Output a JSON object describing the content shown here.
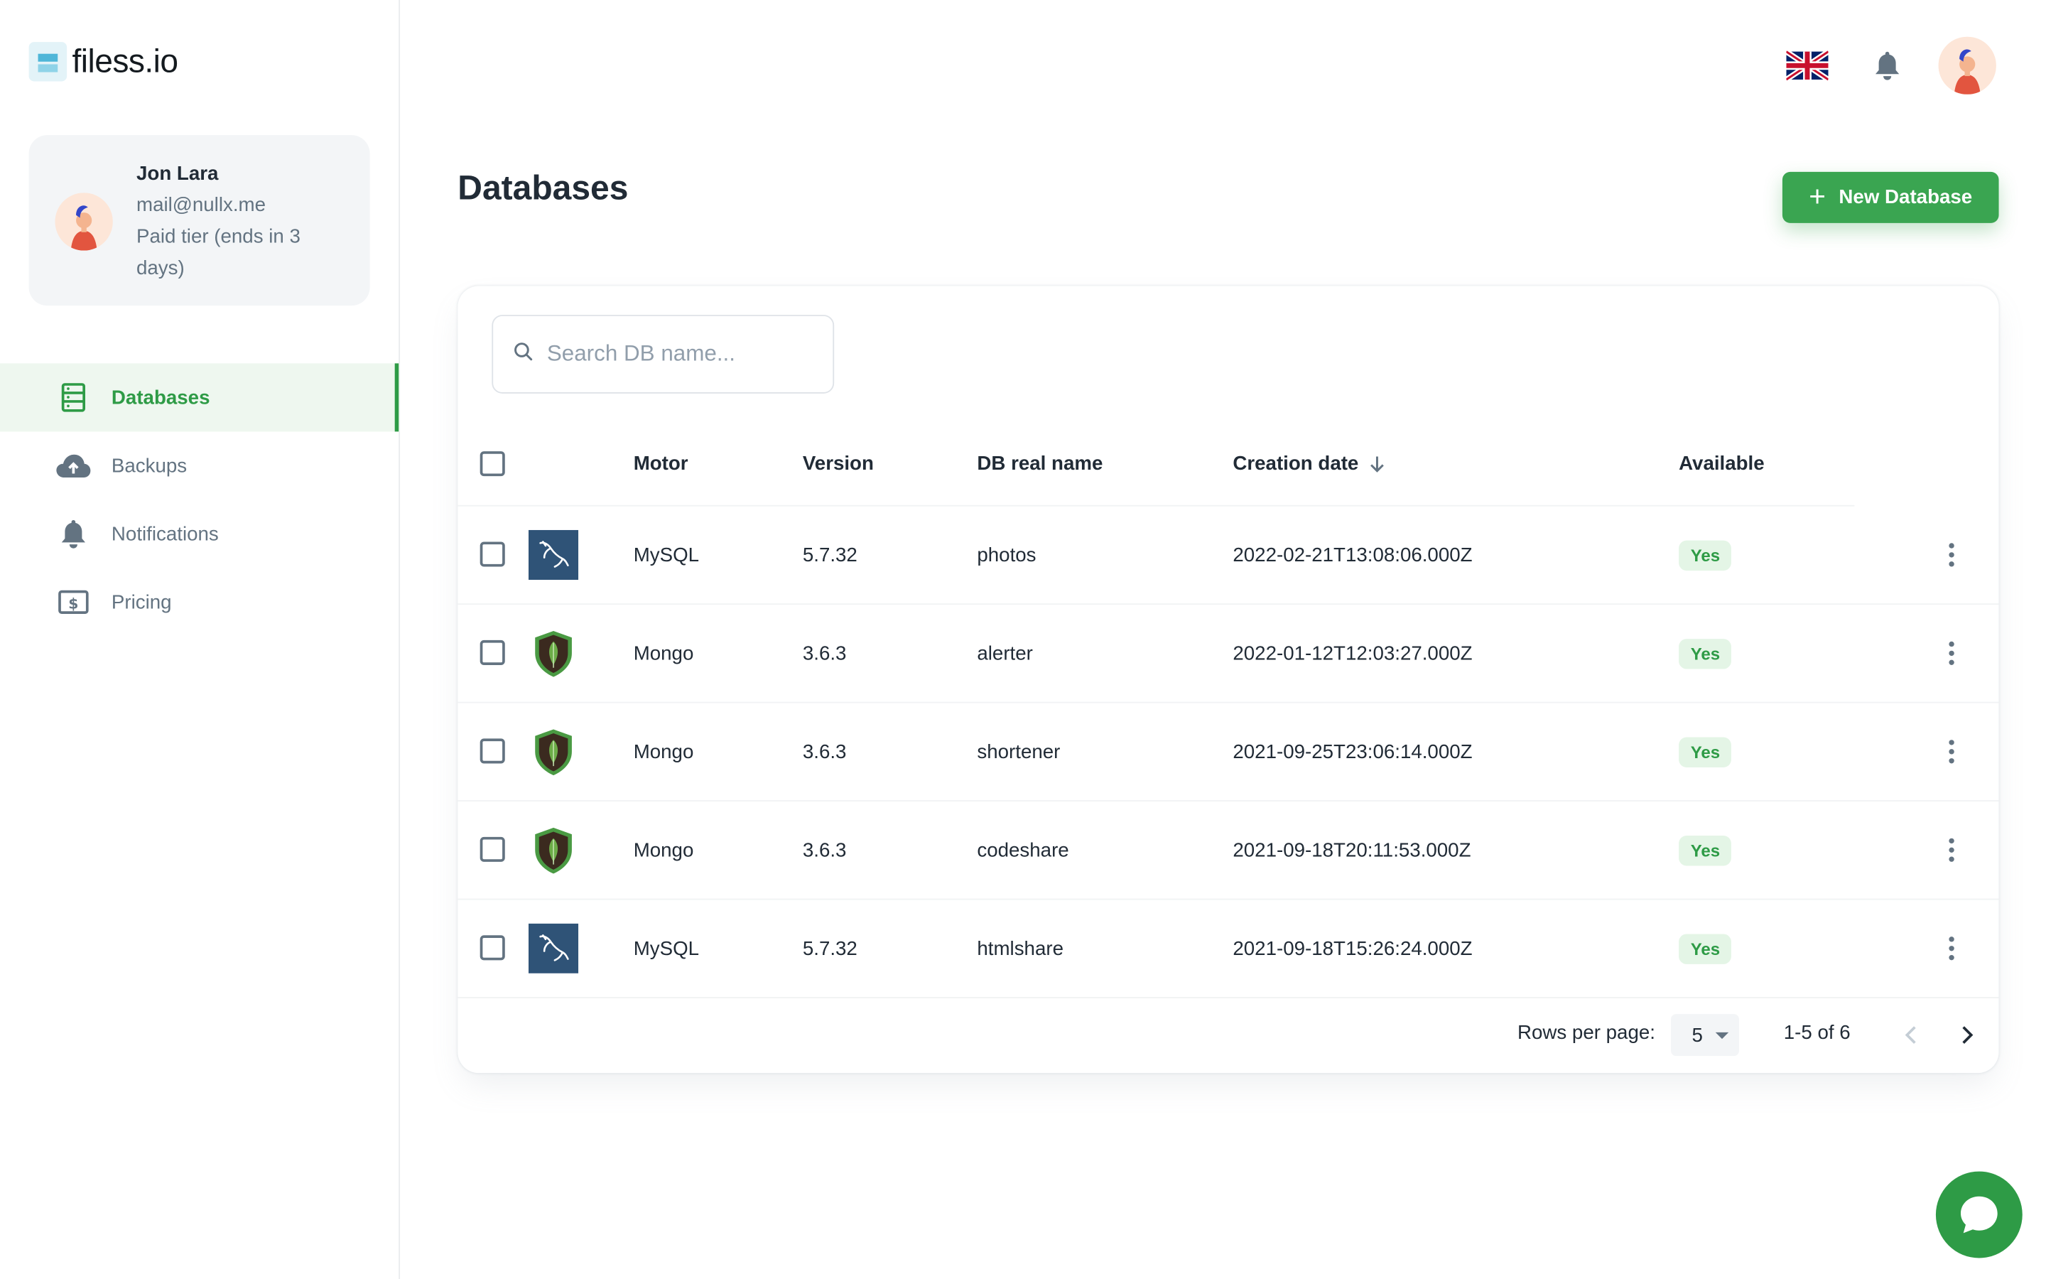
{
  "brand": {
    "name": "filess.io"
  },
  "account": {
    "name": "Jon Lara",
    "email": "mail@nullx.me",
    "plan": "Paid tier (ends in 3 days)"
  },
  "sidebar": {
    "items": [
      {
        "label": "Databases",
        "icon": "database-icon",
        "active": true
      },
      {
        "label": "Backups",
        "icon": "cloud-upload-icon",
        "active": false
      },
      {
        "label": "Notifications",
        "icon": "bell-icon",
        "active": false
      },
      {
        "label": "Pricing",
        "icon": "dollar-bill-icon",
        "active": false
      }
    ]
  },
  "header": {
    "language_icon": "uk-flag-icon",
    "notifications_icon": "bell-icon"
  },
  "page": {
    "title": "Databases",
    "new_button_label": "New Database"
  },
  "search": {
    "placeholder": "Search DB name..."
  },
  "table": {
    "columns": [
      "Motor",
      "Version",
      "DB real name",
      "Creation date",
      "Available"
    ],
    "sorted_column": "Creation date",
    "sort_direction": "desc",
    "rows": [
      {
        "motor": "MySQL",
        "version": "5.7.32",
        "name": "photos",
        "created": "2022-02-21T13:08:06.000Z",
        "available": "Yes",
        "icon": "mysql-icon"
      },
      {
        "motor": "Mongo",
        "version": "3.6.3",
        "name": "alerter",
        "created": "2022-01-12T12:03:27.000Z",
        "available": "Yes",
        "icon": "mongodb-icon"
      },
      {
        "motor": "Mongo",
        "version": "3.6.3",
        "name": "shortener",
        "created": "2021-09-25T23:06:14.000Z",
        "available": "Yes",
        "icon": "mongodb-icon"
      },
      {
        "motor": "Mongo",
        "version": "3.6.3",
        "name": "codeshare",
        "created": "2021-09-18T20:11:53.000Z",
        "available": "Yes",
        "icon": "mongodb-icon"
      },
      {
        "motor": "MySQL",
        "version": "5.7.32",
        "name": "htmlshare",
        "created": "2021-09-18T15:26:24.000Z",
        "available": "Yes",
        "icon": "mysql-icon"
      }
    ]
  },
  "pagination": {
    "rows_per_page_label": "Rows per page:",
    "rows_per_page": "5",
    "range": "1-5 of 6"
  },
  "colors": {
    "accent": "#3aa551",
    "active_bg": "#eef7ef",
    "badge_bg": "#e4f5e6",
    "mysql_bg": "#2f5377",
    "mongo_leaf": "#6cac48"
  }
}
